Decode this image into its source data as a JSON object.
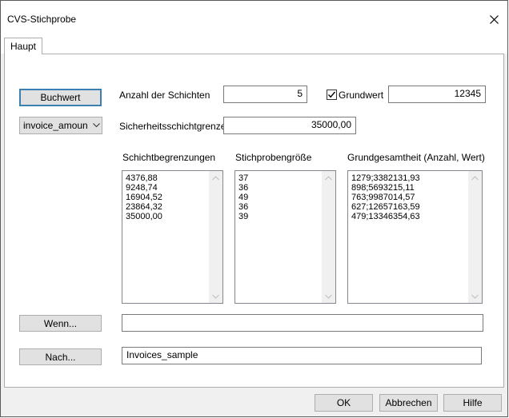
{
  "window": {
    "title": "CVS-Stichprobe"
  },
  "tabs": [
    {
      "label": "Haupt"
    }
  ],
  "controls": {
    "buchwert_button": "Buchwert",
    "field_select": "invoice_amoun",
    "anzahl_label": "Anzahl der Schichten",
    "anzahl_value": "5",
    "grundwert_checkbox_label": "Grundwert",
    "grundwert_checked": true,
    "grundwert_value": "12345",
    "sicherheit_label": "Sicherheitsschichtgrenze",
    "sicherheit_value": "35000,00",
    "wenn_button": "Wenn...",
    "wenn_value": "",
    "nach_button": "Nach...",
    "nach_value": "Invoices_sample"
  },
  "lists": {
    "schicht": {
      "header": "Schichtbegrenzungen",
      "items": [
        "4376,88",
        "9248,74",
        "16904,52",
        "23864,32",
        "35000,00"
      ]
    },
    "stichprobe": {
      "header": "Stichprobengröße",
      "items": [
        "37",
        "36",
        "49",
        "36",
        "39"
      ]
    },
    "grund": {
      "header": "Grundgesamtheit (Anzahl, Wert)",
      "items": [
        "1279;3382131,93",
        "898;5693215,11",
        "763;9987014,57",
        "627;12657163,59",
        "479;13346354,63"
      ]
    }
  },
  "footer": {
    "ok": "OK",
    "cancel": "Abbrechen",
    "help": "Hilfe"
  },
  "icons": {
    "close": "close-icon",
    "dropdown": "chevron-down-icon",
    "check": "checkmark-icon",
    "scroll_up": "scroll-up-arrow-icon",
    "scroll_down": "scroll-down-arrow-icon"
  }
}
